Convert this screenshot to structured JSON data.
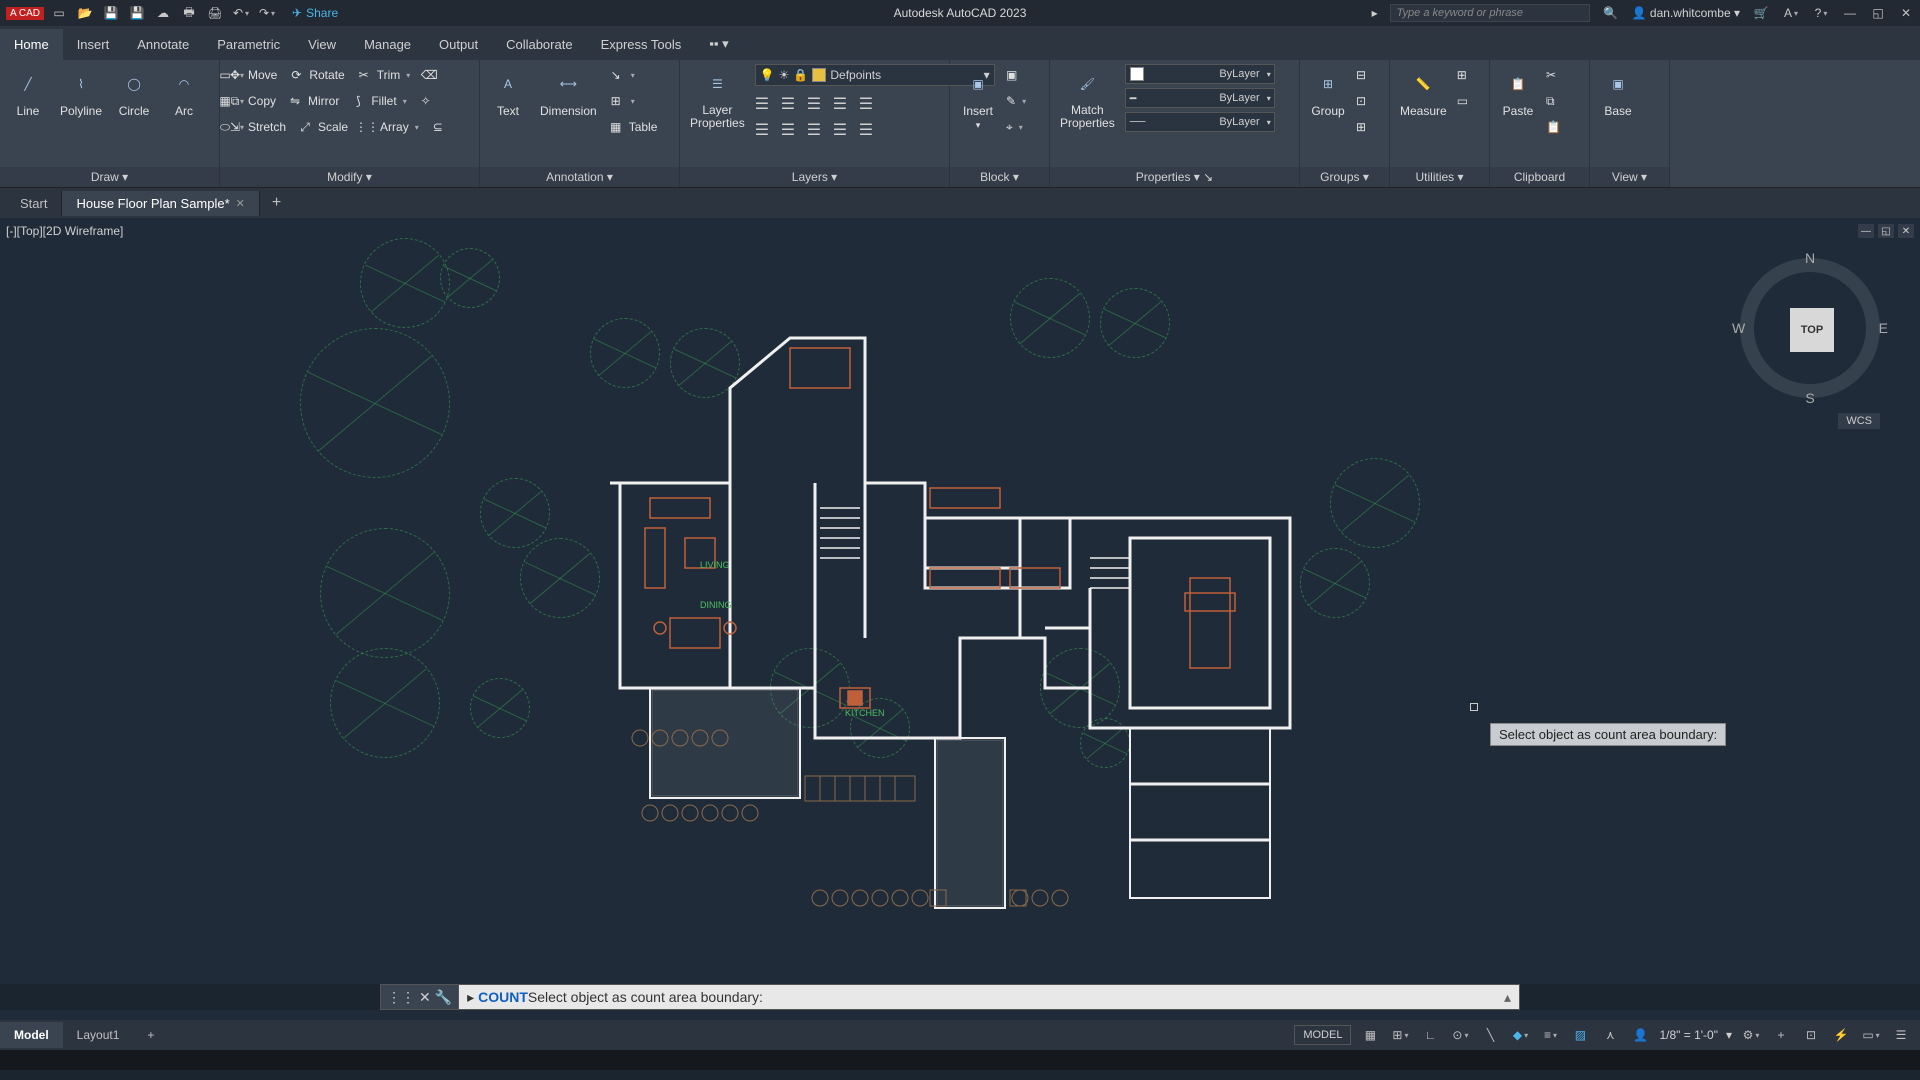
{
  "title": "Autodesk AutoCAD 2023",
  "titlebar": {
    "app_abbr": "CAD",
    "share": "Share",
    "search_placeholder": "Type a keyword or phrase",
    "user": "dan.whitcombe"
  },
  "menu": {
    "items": [
      "Home",
      "Insert",
      "Annotate",
      "Parametric",
      "View",
      "Manage",
      "Output",
      "Collaborate",
      "Express Tools"
    ],
    "active": 0
  },
  "ribbon": {
    "draw": {
      "label": "Draw",
      "line": "Line",
      "polyline": "Polyline",
      "circle": "Circle",
      "arc": "Arc"
    },
    "modify": {
      "label": "Modify",
      "move": "Move",
      "rotate": "Rotate",
      "trim": "Trim",
      "copy": "Copy",
      "mirror": "Mirror",
      "fillet": "Fillet",
      "stretch": "Stretch",
      "scale": "Scale",
      "array": "Array"
    },
    "annotation": {
      "label": "Annotation",
      "text": "Text",
      "dimension": "Dimension",
      "table": "Table"
    },
    "layers": {
      "label": "Layers",
      "properties": "Layer\nProperties",
      "current": "Defpoints"
    },
    "block": {
      "label": "Block",
      "insert": "Insert"
    },
    "properties": {
      "label": "Properties",
      "match": "Match\nProperties",
      "bylayer": "ByLayer"
    },
    "groups": {
      "label": "Groups",
      "group": "Group"
    },
    "utilities": {
      "label": "Utilities",
      "measure": "Measure"
    },
    "clipboard": {
      "label": "Clipboard",
      "paste": "Paste"
    },
    "view": {
      "label": "View",
      "base": "Base"
    }
  },
  "filetabs": {
    "start": "Start",
    "doc": "House Floor Plan Sample*"
  },
  "viewport": {
    "label": "[-][Top][2D Wireframe]"
  },
  "viewcube": {
    "face": "TOP",
    "n": "N",
    "s": "S",
    "e": "E",
    "w": "W",
    "wcs": "WCS"
  },
  "rooms": {
    "living": "LIVING",
    "dining": "DINING",
    "kitchen": "KITCHEN"
  },
  "tooltip": "Select object as count area boundary:",
  "command": {
    "name": "COUNT",
    "prompt": " Select object as count area boundary:"
  },
  "layouts": {
    "model": "Model",
    "layout1": "Layout1"
  },
  "status": {
    "space": "MODEL",
    "scale": "1/8\" = 1'-0\""
  }
}
